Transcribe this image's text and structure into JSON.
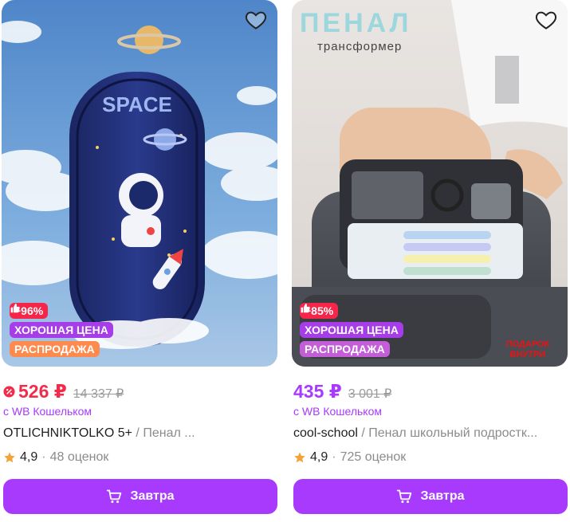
{
  "products": [
    {
      "badges": {
        "discount": "−96%",
        "good_price": "ХОРОШАЯ ЦЕНА",
        "sale": "РАСПРОДАЖА"
      },
      "image_text": {
        "line1": "SPACE"
      },
      "price": "526 ₽",
      "old_price": "14 337 ₽",
      "wallet_note": "с WB Кошельком",
      "brand": "ⓄⓉⓁⓘⒸⒽⓃⒾⓀⓉⓄⓁⓀⓄ ⓈⒺ",
      "brand_display": "OTLICHNIKTOLKO 5+",
      "separator": " / ",
      "name": "Пенал ...",
      "rating": "4,9",
      "rating_dot": "·",
      "reviews": "48 оценок",
      "cta_label": "Завтра",
      "accent": "#f12b49"
    },
    {
      "badges": {
        "discount": "−85%",
        "good_price": "ХОРОШАЯ ЦЕНА",
        "sale": "РАСПРОДАЖА"
      },
      "image_text": {
        "line1": "ПЕНАЛ",
        "line2": "трансформер",
        "gift": "ПОДАРОК\nВНУТРИ"
      },
      "price": "435 ₽",
      "old_price": "3 001 ₽",
      "wallet_note": "с WB Кошельком",
      "brand": "cool-school",
      "separator": " / ",
      "name": "Пенал школьный подростк...",
      "rating": "4,9",
      "rating_dot": "·",
      "reviews": "725 оценок",
      "cta_label": "Завтра",
      "accent": "#a73afd"
    }
  ],
  "colors": {
    "brand_purple": "#a73afd",
    "discount_red": "#f6264a",
    "good_price": "#a63de8",
    "star": "#f2a33a"
  }
}
